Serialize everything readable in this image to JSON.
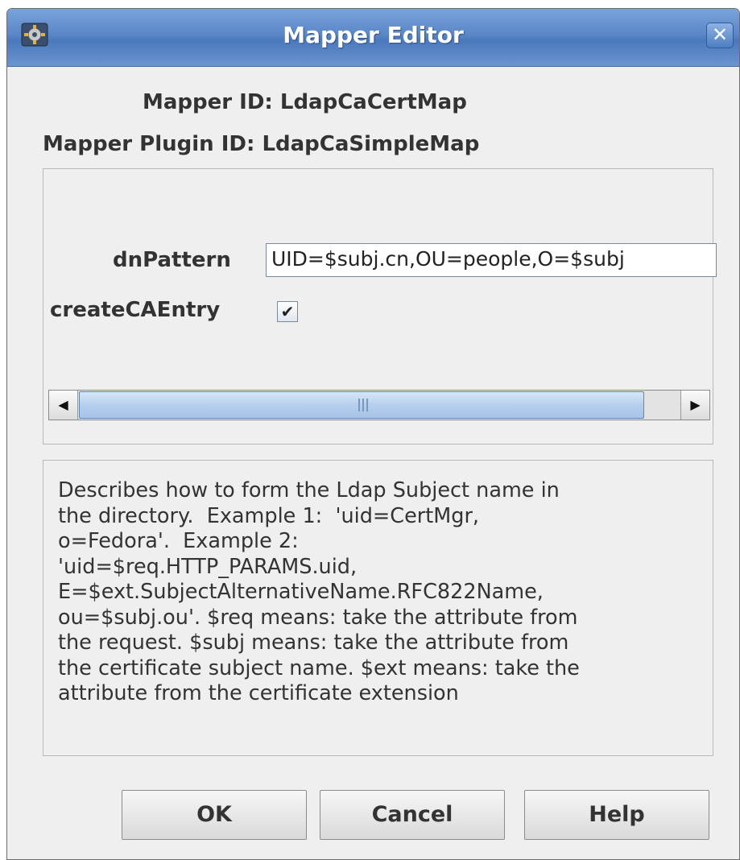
{
  "window": {
    "title": "Mapper Editor",
    "close_glyph": "✕",
    "icon": "app-gear-icon"
  },
  "info": {
    "mapper_id_label": "Mapper ID:",
    "mapper_id_value": "LdapCaCertMap",
    "plugin_id_label": "Mapper Plugin ID:",
    "plugin_id_value": "LdapCaSimpleMap"
  },
  "config": {
    "dn_label": "dnPattern",
    "dn_value": "UID=$subj.cn,OU=people,O=$subj",
    "create_label": "createCAEntry",
    "create_checked": true,
    "check_glyph": "✔"
  },
  "scrollbar": {
    "left_glyph": "◀",
    "right_glyph": "▶"
  },
  "description": "Describes how to form the Ldap Subject name in\nthe directory.  Example 1:  'uid=CertMgr,\no=Fedora'.  Example 2:\n'uid=$req.HTTP_PARAMS.uid,\nE=$ext.SubjectAlternativeName.RFC822Name,\nou=$subj.ou'. $req means: take the attribute from\nthe request. $subj means: take the attribute from\nthe certificate subject name. $ext means: take the\nattribute from the certificate extension",
  "buttons": {
    "ok": "OK",
    "cancel": "Cancel",
    "help": "Help"
  }
}
